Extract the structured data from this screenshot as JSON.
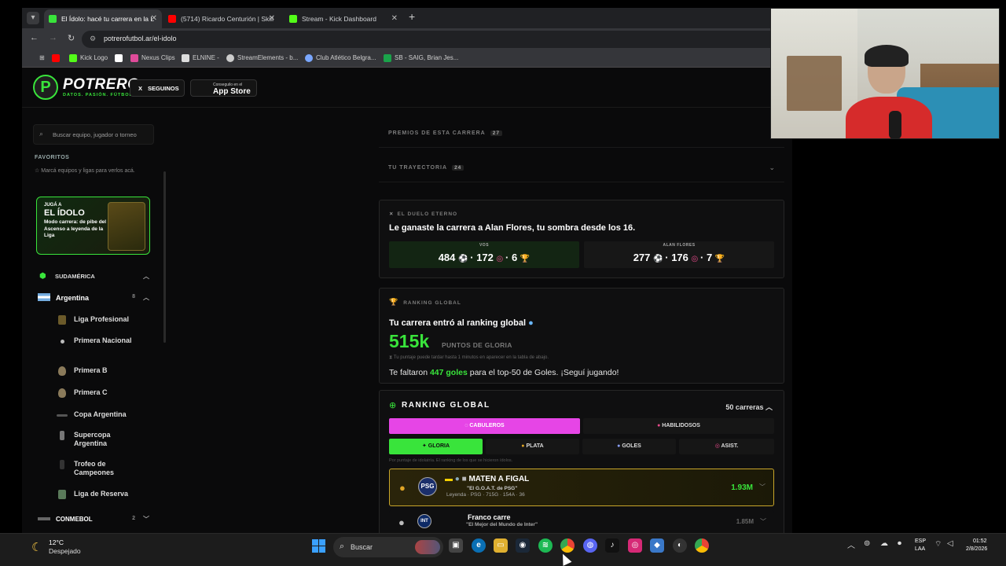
{
  "browser": {
    "tabs": [
      {
        "label": "El Ídolo: hacé tu carrera en la L",
        "favicon_color": "#39e43b"
      },
      {
        "label": "(5714) Ricardo Centurión | Skill",
        "favicon_color": "#ff0000"
      },
      {
        "label": "Stream - Kick Dashboard",
        "favicon_color": "#53fc18"
      }
    ],
    "new_tab": "+",
    "url": "potrerofutbol.ar/el-idolo",
    "bookmarks": [
      {
        "label": "",
        "color": "#ff0000"
      },
      {
        "label": "Kick Logo",
        "color": "#53fc18"
      },
      {
        "label": "",
        "color": "#ffffff"
      },
      {
        "label": "Nexus Clips",
        "color": "#e04b9a"
      },
      {
        "label": "ELNINE -",
        "color": "#dddddd"
      },
      {
        "label": "StreamElements - b...",
        "color": "#cccccc"
      },
      {
        "label": "Club Atlético Belgra...",
        "color": "#7aa7ff"
      },
      {
        "label": "SB - SAIG, Brian Jes...",
        "color": "#1aa34a"
      }
    ]
  },
  "site": {
    "logo": "POTRERO",
    "tagline": "DATOS. PASIÓN. FÚTBOL.",
    "follow_label": "SEGUINOS",
    "follow_icon": "X",
    "appstore_small": "Conseguilo en el",
    "appstore_big": "App Store"
  },
  "sidebar": {
    "search_placeholder": "Buscar equipo, jugador o torneo",
    "favorites_title": "FAVORITOS",
    "favorites_hint": "Marcá equipos y ligas para verlos acá.",
    "promo": {
      "kicker": "JUGÁ A",
      "title": "EL ÍDOLO",
      "text": "Modo carrera: de pibe del Ascenso a leyenda de la Liga"
    },
    "region": "SUDAMÉRICA",
    "country": "Argentina",
    "country_count": "8",
    "leagues": [
      "Liga Profesional",
      "Primera Nacional",
      "Primera B",
      "Primera C",
      "Copa Argentina",
      "Supercopa Argentina",
      "Trofeo de Campeones",
      "Liga de Reserva"
    ],
    "conmebol": "CONMEBOL",
    "conmebol_count": "2"
  },
  "main": {
    "premios": {
      "label": "PREMIOS DE ESTA CARRERA",
      "count": "27"
    },
    "trayectoria": {
      "label": "TU TRAYECTORIA",
      "count": "24"
    },
    "duel": {
      "kicker": "EL DUELO ETERNO",
      "headline": "Le ganaste la carrera a Alan Flores, tu sombra desde los 16.",
      "you": {
        "label": "VOS",
        "goals": "484",
        "assists": "172",
        "titles": "6"
      },
      "rival": {
        "label": "ALAN FLORES",
        "goals": "277",
        "assists": "176",
        "titles": "7"
      }
    },
    "ranking_card": {
      "kicker": "RANKING GLOBAL",
      "heading": "Tu carrera entró al ranking global",
      "points": "515k",
      "points_unit": "PUNTOS DE GLORIA",
      "note": "Tu puntaje puede tardar hasta 1 minutos en aparecer en la tabla de abajo.",
      "missing_pre": "Te faltaron",
      "missing_value": "447 goles",
      "missing_post": "para el top-50 de Goles. ¡Seguí jugando!"
    },
    "ranking_list": {
      "title": "RANKING GLOBAL",
      "count": "50 carreras",
      "mode_tabs": [
        "CABULEROS",
        "HABILIDOSOS"
      ],
      "metric_tabs": [
        "GLORIA",
        "PLATA",
        "GOLES",
        "ASIST."
      ],
      "hint": "Por puntaje de idolatría. El ranking de los que se hicieron ídolos.",
      "entries": [
        {
          "name": "MATEN A FIGAL",
          "nickname": "\"El G.O.A.T. de PSG\"",
          "meta": "Leyenda · PSG · 715G · 154A · 36",
          "club": "PSG",
          "points": "1.93M"
        },
        {
          "name": "Franco carre",
          "nickname": "\"El Mejor del Mundo de Inter\"",
          "meta": "",
          "club": "INT",
          "points": "1.85M"
        }
      ]
    }
  },
  "taskbar": {
    "temp": "12°C",
    "weather": "Despejado",
    "search_placeholder": "Buscar",
    "lang_1": "ESP",
    "lang_2": "LAA",
    "time": "01:52",
    "date": "2/8/2026"
  }
}
